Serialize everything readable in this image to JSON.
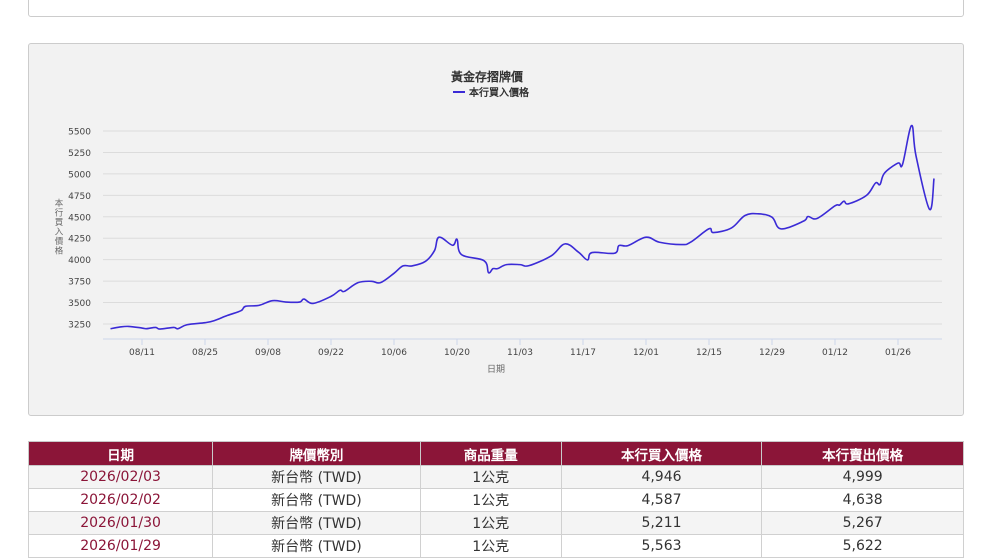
{
  "chart_data": {
    "type": "line",
    "title": "黃金存摺牌價",
    "legend": "本行買入價格",
    "legend_position": "top-right",
    "xlabel": "日期",
    "ylabel": "本行買入價格",
    "ylim": [
      3075,
      5560
    ],
    "yticks": [
      3250,
      3500,
      3750,
      4000,
      4250,
      4500,
      4750,
      5000,
      5250,
      5500
    ],
    "xticks": [
      {
        "d": "2025-08-11",
        "label": "08/11"
      },
      {
        "d": "2025-08-25",
        "label": "08/25"
      },
      {
        "d": "2025-09-08",
        "label": "09/08"
      },
      {
        "d": "2025-09-22",
        "label": "09/22"
      },
      {
        "d": "2025-10-06",
        "label": "10/06"
      },
      {
        "d": "2025-10-20",
        "label": "10/20"
      },
      {
        "d": "2025-11-03",
        "label": "11/03"
      },
      {
        "d": "2025-11-17",
        "label": "11/17"
      },
      {
        "d": "2025-12-01",
        "label": "12/01"
      },
      {
        "d": "2025-12-15",
        "label": "12/15"
      },
      {
        "d": "2025-12-29",
        "label": "12/29"
      },
      {
        "d": "2026-01-12",
        "label": "01/12"
      },
      {
        "d": "2026-01-26",
        "label": "01/26"
      }
    ],
    "line_color": "#3b2bd6",
    "series": [
      [
        "2025-08-04",
        3195
      ],
      [
        "2025-08-06",
        3214
      ],
      [
        "2025-08-08",
        3222
      ],
      [
        "2025-08-11",
        3203
      ],
      [
        "2025-08-12",
        3195
      ],
      [
        "2025-08-14",
        3210
      ],
      [
        "2025-08-15",
        3191
      ],
      [
        "2025-08-18",
        3210
      ],
      [
        "2025-08-19",
        3195
      ],
      [
        "2025-08-21",
        3241
      ],
      [
        "2025-08-25",
        3265
      ],
      [
        "2025-08-27",
        3288
      ],
      [
        "2025-08-30",
        3350
      ],
      [
        "2025-09-02",
        3405
      ],
      [
        "2025-09-03",
        3456
      ],
      [
        "2025-09-06",
        3467
      ],
      [
        "2025-09-09",
        3522
      ],
      [
        "2025-09-12",
        3506
      ],
      [
        "2025-09-15",
        3506
      ],
      [
        "2025-09-16",
        3541
      ],
      [
        "2025-09-18",
        3490
      ],
      [
        "2025-09-22",
        3572
      ],
      [
        "2025-09-24",
        3643
      ],
      [
        "2025-09-25",
        3631
      ],
      [
        "2025-09-28",
        3732
      ],
      [
        "2025-10-01",
        3748
      ],
      [
        "2025-10-03",
        3732
      ],
      [
        "2025-10-06",
        3841
      ],
      [
        "2025-10-08",
        3927
      ],
      [
        "2025-10-10",
        3927
      ],
      [
        "2025-10-13",
        3981
      ],
      [
        "2025-10-15",
        4106
      ],
      [
        "2025-10-16",
        4262
      ],
      [
        "2025-10-19",
        4168
      ],
      [
        "2025-10-20",
        4238
      ],
      [
        "2025-10-21",
        4059
      ],
      [
        "2025-10-26",
        3988
      ],
      [
        "2025-10-27",
        3849
      ],
      [
        "2025-10-28",
        3895
      ],
      [
        "2025-10-29",
        3895
      ],
      [
        "2025-10-31",
        3942
      ],
      [
        "2025-11-03",
        3942
      ],
      [
        "2025-11-05",
        3930
      ],
      [
        "2025-11-10",
        4047
      ],
      [
        "2025-11-13",
        4184
      ],
      [
        "2025-11-16",
        4087
      ],
      [
        "2025-11-18",
        3997
      ],
      [
        "2025-11-19",
        4083
      ],
      [
        "2025-11-24",
        4075
      ],
      [
        "2025-11-25",
        4164
      ],
      [
        "2025-11-27",
        4164
      ],
      [
        "2025-12-01",
        4262
      ],
      [
        "2025-12-04",
        4203
      ],
      [
        "2025-12-09",
        4176
      ],
      [
        "2025-12-11",
        4207
      ],
      [
        "2025-12-15",
        4360
      ],
      [
        "2025-12-16",
        4316
      ],
      [
        "2025-12-20",
        4370
      ],
      [
        "2025-12-23",
        4515
      ],
      [
        "2025-12-26",
        4534
      ],
      [
        "2025-12-29",
        4495
      ],
      [
        "2025-12-31",
        4359
      ],
      [
        "2026-01-05",
        4449
      ],
      [
        "2026-01-06",
        4503
      ],
      [
        "2026-01-08",
        4480
      ],
      [
        "2026-01-12",
        4628
      ],
      [
        "2026-01-13",
        4636
      ],
      [
        "2026-01-14",
        4682
      ],
      [
        "2026-01-15",
        4651
      ],
      [
        "2026-01-19",
        4749
      ],
      [
        "2026-01-21",
        4893
      ],
      [
        "2026-01-22",
        4877
      ],
      [
        "2026-01-23",
        5009
      ],
      [
        "2026-01-26",
        5126
      ],
      [
        "2026-01-27",
        5110
      ],
      [
        "2026-01-29",
        5563
      ],
      [
        "2026-01-30",
        5211
      ],
      [
        "2026-02-02",
        4587
      ],
      [
        "2026-02-03",
        4946
      ]
    ]
  },
  "table": {
    "headers": [
      "日期",
      "牌價幣別",
      "商品重量",
      "本行買入價格",
      "本行賣出價格"
    ],
    "rows": [
      [
        "2026/02/03",
        "新台幣 (TWD)",
        "1公克",
        "4,946",
        "4,999"
      ],
      [
        "2026/02/02",
        "新台幣 (TWD)",
        "1公克",
        "4,587",
        "4,638"
      ],
      [
        "2026/01/30",
        "新台幣 (TWD)",
        "1公克",
        "5,211",
        "5,267"
      ],
      [
        "2026/01/29",
        "新台幣 (TWD)",
        "1公克",
        "5,563",
        "5,622"
      ]
    ]
  }
}
